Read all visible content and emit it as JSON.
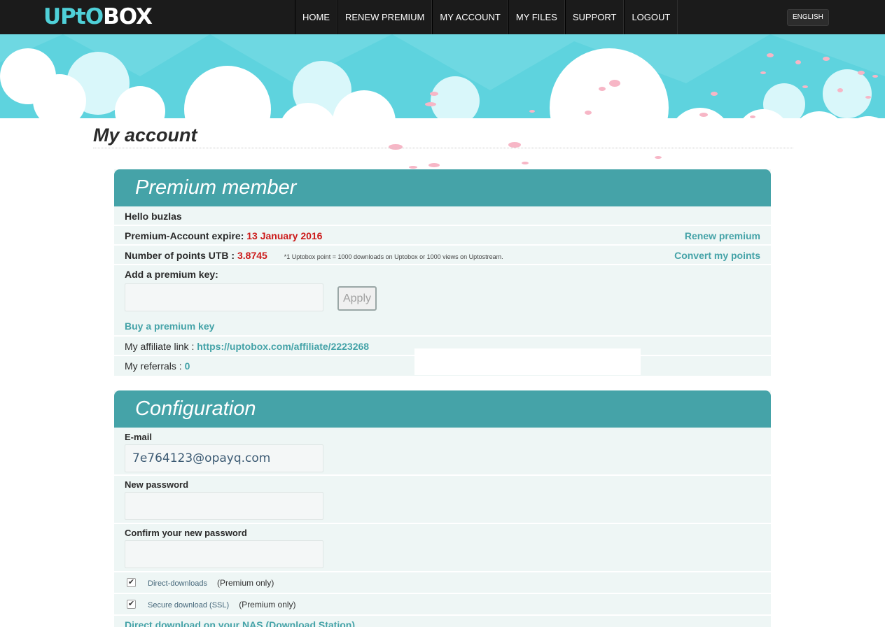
{
  "header": {
    "logo_part1": "UPtO",
    "logo_part2": "BOX",
    "nav": [
      "HOME",
      "RENEW PREMIUM",
      "MY ACCOUNT",
      "MY FILES",
      "SUPPORT",
      "LOGOUT"
    ],
    "language": "ENGLISH"
  },
  "page": {
    "title": "My account"
  },
  "premium": {
    "title": "Premium member",
    "hello": "Hello buzlas",
    "expire_label": "Premium-Account expire:",
    "expire_value": "13 January 2016",
    "renew_link": "Renew premium",
    "points_label": "Number of points UTB :",
    "points_value": "3.8745",
    "points_note": "*1 Uptobox point = 1000 downloads on Uptobox or 1000 views on Uptostream.",
    "convert_link": "Convert my points",
    "key_label": "Add a premium key:",
    "key_value": "",
    "apply_label": "Apply",
    "buy_link": "Buy a premium key",
    "affiliate_label": "My affiliate link :",
    "affiliate_url": "https://uptobox.com/affiliate/2223268",
    "referrals_label": "My referrals :",
    "referrals_value": "0"
  },
  "config": {
    "title": "Configuration",
    "email_label": "E-mail",
    "email_value": "7e764123@opayq.com",
    "newpass_label": "New password",
    "confirm_label": "Confirm your new password",
    "options": [
      {
        "label": "Direct-downloads",
        "note": "(Premium only)",
        "checked": true
      },
      {
        "label": "Secure download (SSL)",
        "note": "(Premium only)",
        "checked": true
      }
    ],
    "nas_link": "Direct download on your NAS (Download Station)"
  },
  "colors": {
    "accent": "#45a3a8",
    "navbar": "#1b1b1b",
    "expire": "#cc1a1a",
    "sky": "#5ed3de"
  }
}
